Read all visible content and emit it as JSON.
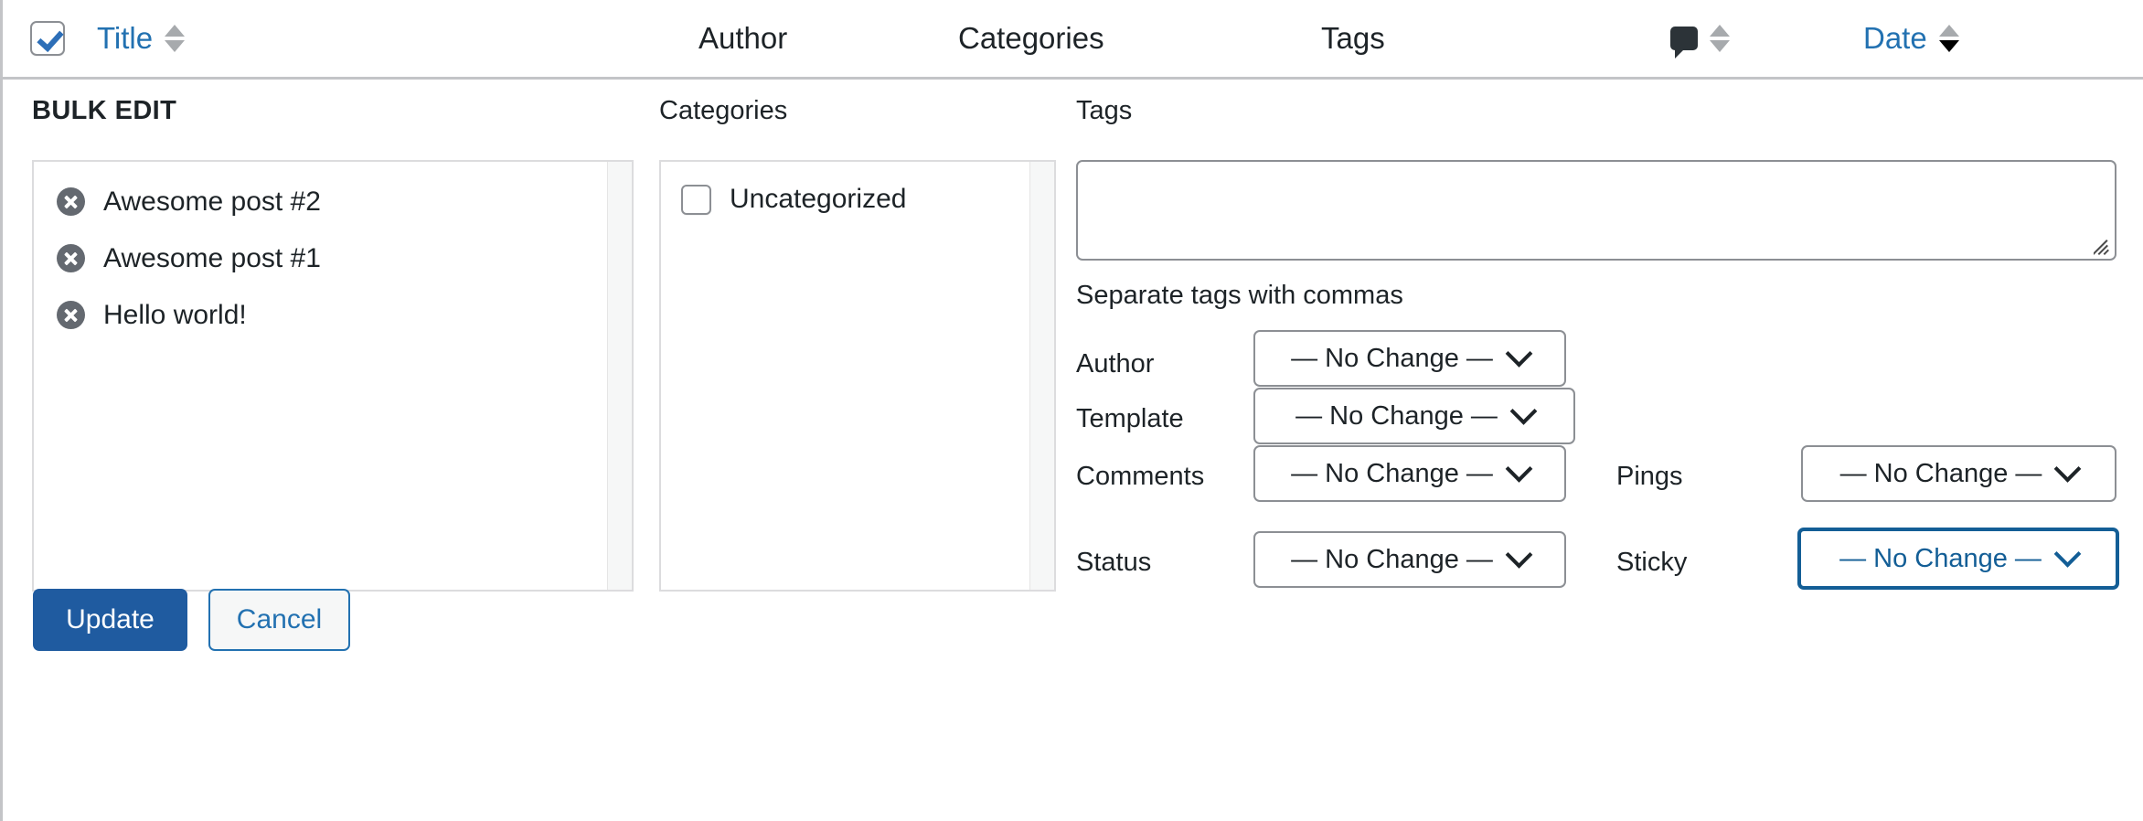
{
  "table_header": {
    "select_all_checked": true,
    "columns": [
      {
        "key": "title",
        "label": "Title",
        "sortable": true,
        "link": true
      },
      {
        "key": "author",
        "label": "Author",
        "sortable": false,
        "link": false
      },
      {
        "key": "categories",
        "label": "Categories",
        "sortable": false,
        "link": false
      },
      {
        "key": "tags",
        "label": "Tags",
        "sortable": false,
        "link": false
      },
      {
        "key": "comments",
        "label": "",
        "sortable": true,
        "link": false,
        "icon": "comment-bubble-icon"
      },
      {
        "key": "date",
        "label": "Date",
        "sortable": true,
        "link": true,
        "sort_direction": "desc"
      }
    ],
    "title_label": "Title",
    "author_label": "Author",
    "categories_label": "Categories",
    "tags_label": "Tags",
    "date_label": "Date"
  },
  "bulk_edit": {
    "heading": "BULK EDIT",
    "posts": [
      {
        "title": "Awesome post #2",
        "remove_icon": "remove-circle-icon"
      },
      {
        "title": "Awesome post #1",
        "remove_icon": "remove-circle-icon"
      },
      {
        "title": "Hello world!",
        "remove_icon": "remove-circle-icon"
      }
    ],
    "categories": {
      "label": "Categories",
      "items": [
        {
          "label": "Uncategorized",
          "checked": false
        }
      ]
    },
    "tags": {
      "label": "Tags",
      "value": "",
      "placeholder": "",
      "helper": "Separate tags with commas"
    },
    "fields": {
      "author": {
        "label": "Author",
        "value": "— No Change —",
        "focused": false
      },
      "template": {
        "label": "Template",
        "value": "— No Change —",
        "focused": false
      },
      "comments": {
        "label": "Comments",
        "value": "— No Change —",
        "focused": false
      },
      "pings": {
        "label": "Pings",
        "value": "— No Change —",
        "focused": false
      },
      "status": {
        "label": "Status",
        "value": "— No Change —",
        "focused": false
      },
      "sticky": {
        "label": "Sticky",
        "value": "— No Change —",
        "focused": true
      }
    },
    "actions": {
      "update_label": "Update",
      "cancel_label": "Cancel"
    }
  },
  "colors": {
    "link_blue": "#2271b1",
    "primary_button_blue": "#1f5ba0",
    "focus_blue": "#135e96",
    "text_dark": "#1d2327",
    "icon_gray": "#646970",
    "border_gray": "#8c8f94",
    "divider_gray": "#c3c4c7"
  }
}
